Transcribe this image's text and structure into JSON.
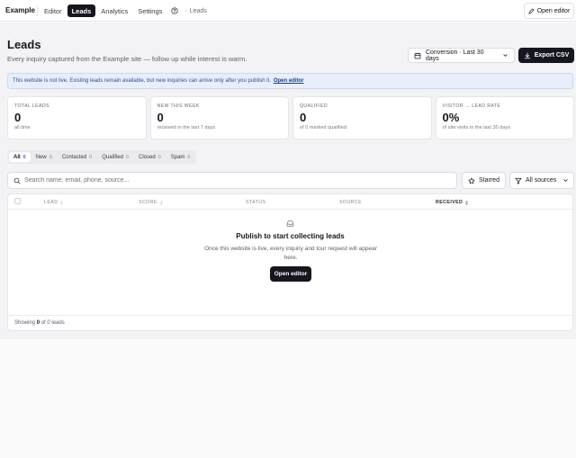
{
  "topbar": {
    "brand": "Example",
    "tabs": [
      {
        "label": "Editor"
      },
      {
        "label": "Leads"
      },
      {
        "label": "Analytics"
      },
      {
        "label": "Settings"
      }
    ],
    "breadcrumb_sep": "·",
    "breadcrumb": "Leads",
    "open_editor_label": "Open editor"
  },
  "header": {
    "title": "Leads",
    "subtitle": "Every inquiry captured from the Example site — follow up while interest is warm.",
    "range_select": "Conversion · Last 30 days",
    "export_label": "Export CSV"
  },
  "notice": {
    "text": "This website is not live. Existing leads remain available, but new inquiries can arrive only after you publish it.",
    "link": "Open editor"
  },
  "stats": [
    {
      "label": "TOTAL LEADS",
      "value": "0",
      "note": "all time"
    },
    {
      "label": "NEW THIS WEEK",
      "value": "0",
      "note": "received in the last 7 days"
    },
    {
      "label": "QUALIFIED",
      "value": "0",
      "note": "of 0 marked qualified"
    },
    {
      "label": "VISITOR → LEAD RATE",
      "value": "0%",
      "note": "of site visits in the last 30 days"
    }
  ],
  "filters": [
    {
      "label": "All",
      "count": "0"
    },
    {
      "label": "New",
      "count": "0"
    },
    {
      "label": "Contacted",
      "count": "0"
    },
    {
      "label": "Qualified",
      "count": "0"
    },
    {
      "label": "Closed",
      "count": "0"
    },
    {
      "label": "Spam",
      "count": "0"
    }
  ],
  "search": {
    "placeholder": "Search name, email, phone, source..."
  },
  "toolbar": {
    "starred_label": "Starred",
    "sources_label": "All sources"
  },
  "table": {
    "columns": [
      "LEAD",
      "SCORE",
      "STATUS",
      "SOURCE",
      "RECEIVED"
    ],
    "empty_title": "Publish to start collecting leads",
    "empty_desc": "Once this website is live, every inquiry and tour request will appear here.",
    "empty_button": "Open editor",
    "footer_prefix": "Showing",
    "footer_count": "0",
    "footer_suffix": "of 0 leads"
  },
  "colors": {
    "accent": "#16161f",
    "notice_bg": "#e8eefb",
    "notice_text": "#2f4f9a",
    "count_accent": "#3b6ed6"
  }
}
